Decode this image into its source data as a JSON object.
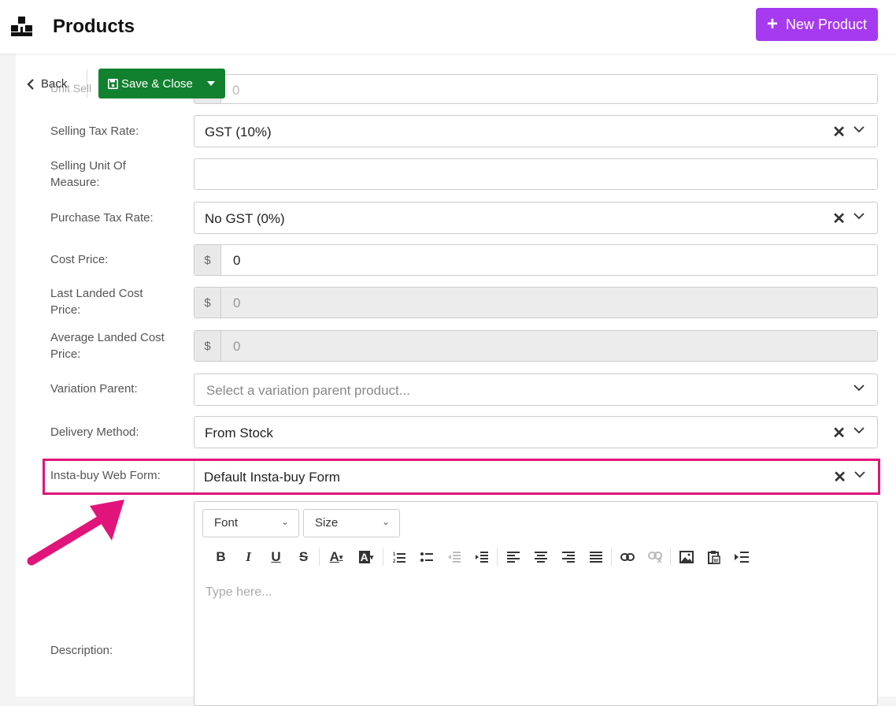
{
  "header": {
    "title": "Products",
    "new_button_label": "New Product",
    "accent_color": "#a63af0"
  },
  "toolbar": {
    "back_label": "Back",
    "save_label": "Save & Close"
  },
  "form": {
    "ghost_label": "Unit Sell",
    "ghost_value": "0",
    "selling_tax_rate": {
      "label": "Selling Tax Rate:",
      "value": "GST (10%)"
    },
    "selling_unit": {
      "label": "Selling Unit Of Measure:",
      "value": ""
    },
    "purchase_tax_rate": {
      "label": "Purchase Tax Rate:",
      "value": "No GST (0%)"
    },
    "cost_price": {
      "label": "Cost Price:",
      "currency": "$",
      "value": "0"
    },
    "last_landed_cost": {
      "label": "Last Landed Cost Price:",
      "currency": "$",
      "value": "0"
    },
    "avg_landed_cost": {
      "label": "Average Landed Cost Price:",
      "currency": "$",
      "value": "0"
    },
    "variation_parent": {
      "label": "Variation Parent:",
      "placeholder": "Select a variation parent product..."
    },
    "delivery_method": {
      "label": "Delivery Method:",
      "value": "From Stock"
    },
    "insta_buy_form": {
      "label": "Insta-buy Web Form:",
      "value": "Default Insta-buy Form"
    },
    "description": {
      "label": "Description:",
      "font_select": "Font",
      "size_select": "Size",
      "placeholder": "Type here..."
    }
  },
  "colors": {
    "save_green": "#12812f",
    "highlight_pink": "#e0147a"
  },
  "icons": [
    "boxes-logo-icon",
    "plus-icon",
    "chevron-left-icon",
    "save-icon",
    "caret-down-icon",
    "clear-icon",
    "chevron-down-icon"
  ]
}
